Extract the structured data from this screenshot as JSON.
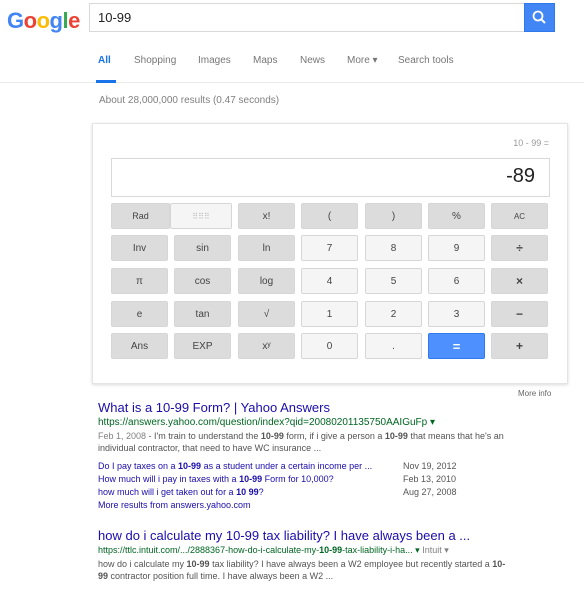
{
  "logo": {
    "letters": [
      "G",
      "o",
      "o",
      "g",
      "l",
      "e"
    ],
    "colors": [
      "#4285f4",
      "#ea4335",
      "#fbbc05",
      "#4285f4",
      "#34a853",
      "#ea4335"
    ]
  },
  "search": {
    "query": "10-99"
  },
  "tabs": [
    "All",
    "Shopping",
    "Images",
    "Maps",
    "News",
    "More ▾",
    "Search tools"
  ],
  "result_stats": "About 28,000,000 results (0.47 seconds)",
  "calculator": {
    "expression": "10 - 99 =",
    "display": "-89",
    "rows": [
      [
        "Rad",
        "",
        "x!",
        "(",
        ")",
        "%",
        "AC"
      ],
      [
        "Inv",
        "sin",
        "ln",
        "7",
        "8",
        "9",
        "÷"
      ],
      [
        "π",
        "cos",
        "log",
        "4",
        "5",
        "6",
        "×"
      ],
      [
        "e",
        "tan",
        "√",
        "1",
        "2",
        "3",
        "−"
      ],
      [
        "Ans",
        "EXP",
        "xʸ",
        "0",
        ".",
        "=",
        "+"
      ]
    ],
    "more_info": "More info"
  },
  "results": [
    {
      "title": "What is a 10-99 Form? | Yahoo Answers",
      "url": "https://answers.yahoo.com/question/index?qid=20080201135750AAIGuFp ▾",
      "date": "Feb 1, 2008",
      "snippet_1": " - I'm train to understand the ",
      "snippet_2": "10-99",
      "snippet_3": " form, if i give a person a ",
      "snippet_4": "10-99",
      "snippet_5": " that means that he's an",
      "snippet_line2": "individual contractor, that need to have WC insurance ...",
      "sub_links": [
        {
          "pre": "Do I pay taxes on a ",
          "bold": "10-99",
          "post": " as a student under a certain income per ...",
          "date": "Nov 19, 2012"
        },
        {
          "pre": "How much will i pay in taxes with a ",
          "bold": "10-99",
          "post": " Form for 10,000?",
          "date": "Feb 13, 2010"
        },
        {
          "pre": "how much will i get taken out for a ",
          "bold": "10 99",
          "post": "?",
          "date": "Aug 27, 2008"
        }
      ],
      "more_results": "More results from answers.yahoo.com"
    },
    {
      "title": "how do i calculate my 10-99 tax liability? I have always been a ...",
      "url_pre": "https://ttlc.intuit.com/.../2888367-how-do-i-calculate-my-",
      "url_bold": "10-99",
      "url_post": "-tax-liability-i-ha... ▾",
      "url_site": "Intuit ▾",
      "snippet_pre": "how do i calculate my ",
      "snippet_bold": "10-99",
      "snippet_mid": " tax liability? I have always been a W2 employee but recently started a ",
      "snippet_bold2": "10-",
      "snippet_line2_bold": "99",
      "snippet_line2": " contractor position full time. I have always been a W2 ..."
    }
  ]
}
